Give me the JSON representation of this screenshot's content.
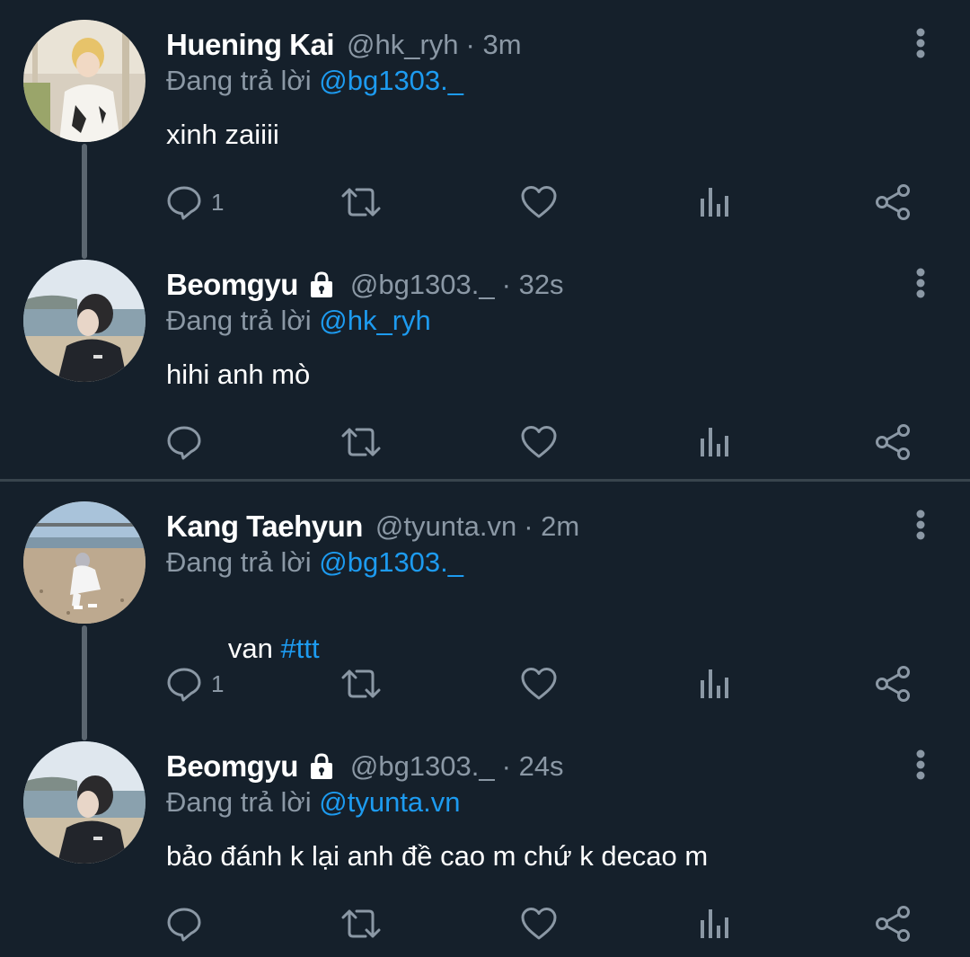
{
  "threads": [
    {
      "tweets": [
        {
          "display_name": "Huening Kai",
          "locked": false,
          "handle": "@hk_ryh",
          "time": "· 3m",
          "reply_prefix": "Đang trả lời",
          "reply_to": "@bg1303._",
          "text": "xinh zaiiii",
          "hashtag": "",
          "reply_count": "1"
        },
        {
          "display_name": "Beomgyu",
          "locked": true,
          "handle": "@bg1303._",
          "time": "· 32s",
          "reply_prefix": "Đang trả lời",
          "reply_to": "@hk_ryh",
          "text": "hihi anh mò",
          "hashtag": "",
          "reply_count": ""
        }
      ]
    },
    {
      "tweets": [
        {
          "display_name": "Kang Taehyun",
          "locked": false,
          "handle": "@tyunta.vn",
          "time": "· 2m",
          "reply_prefix": "Đang trả lời",
          "reply_to": "@bg1303._",
          "text": "van ",
          "hashtag": "#ttt",
          "reply_count": "1"
        },
        {
          "display_name": "Beomgyu",
          "locked": true,
          "handle": "@bg1303._",
          "time": "· 24s",
          "reply_prefix": "Đang trả lời",
          "reply_to": "@tyunta.vn",
          "text": "bảo đánh k lại anh đề cao m chứ k decao m",
          "hashtag": "",
          "reply_count": ""
        }
      ]
    }
  ],
  "icons": {
    "reply": "reply-icon",
    "retweet": "retweet-icon",
    "like": "heart-icon",
    "stats": "analytics-icon",
    "share": "share-icon",
    "more": "more-vertical-icon",
    "lock": "lock-icon"
  },
  "colors": {
    "background": "#15202b",
    "text_primary": "#ffffff",
    "text_secondary": "#8b98a5",
    "accent": "#1d9bf0",
    "thread_line": "#5b6670",
    "divider": "#38444d"
  }
}
